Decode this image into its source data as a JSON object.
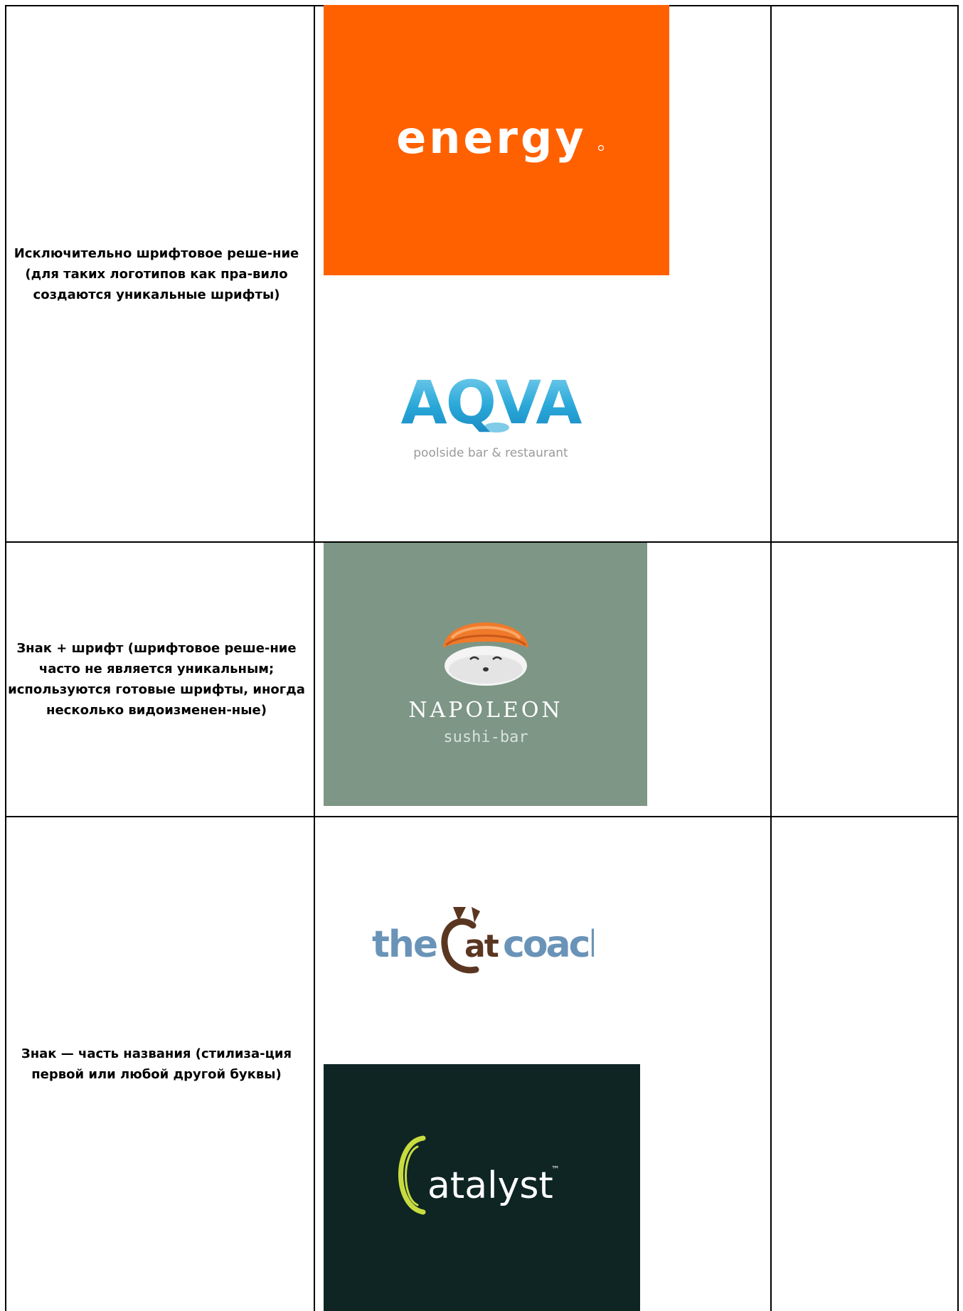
{
  "rows": [
    {
      "description": "Исключительно шрифтовое реше-ние (для таких логотипов как пра-вило создаются уникальные шрифты)",
      "logos": [
        {
          "name": "energy",
          "text": "energy",
          "background": "#FF6100",
          "foreground": "#FFFFFF"
        },
        {
          "name": "aqva",
          "text": "AQVA",
          "subtitle": "poolside bar & restaurant",
          "background": "#FFFFFF",
          "foreground": "#29A8D8",
          "accent": "#7FD0EE"
        }
      ]
    },
    {
      "description": "Знак + шрифт (шрифтовое реше-ние часто не является уникальным; используются готовые шрифты, иногда несколько видоизменен-ные)",
      "logos": [
        {
          "name": "napoleon",
          "text": "NAPOLEON",
          "subtitle": "sushi-bar",
          "background": "#7D9686",
          "foreground": "#FFFFFF",
          "accent": "#F07A2A"
        }
      ]
    },
    {
      "description": "Знак — часть названия (стилиза-ция первой или любой другой буквы)",
      "logos": [
        {
          "name": "the-cat-coach",
          "text_before": "the",
          "text_mark": "at",
          "text_after": "coach",
          "background": "#FFFFFF",
          "foreground": "#6A93B8",
          "mark_color": "#5A3621"
        },
        {
          "name": "catalyst",
          "text": "atalyst",
          "trademark": "™",
          "background": "#0E2524",
          "foreground": "#FFFFFF",
          "mark_color": "#C9DC3F"
        }
      ]
    }
  ]
}
